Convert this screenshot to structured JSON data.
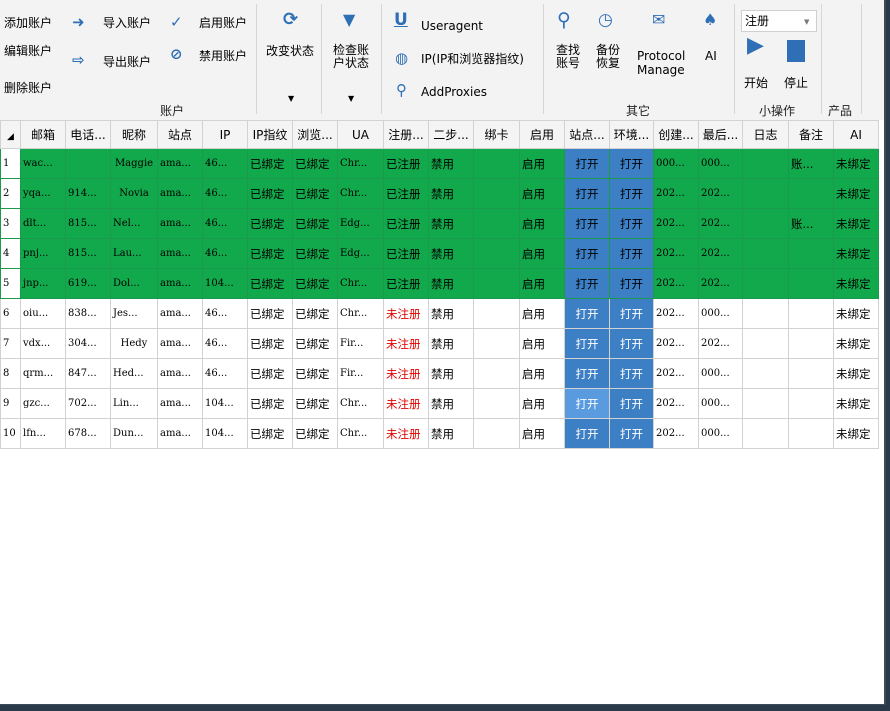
{
  "ribbon": {
    "account_group": {
      "label": "账户",
      "add": "添加账户",
      "edit": "编辑账户",
      "delete": "删除账户",
      "import": "导入账户",
      "export": "导出账户",
      "enable": "启用账户",
      "disable": "禁用账户"
    },
    "change_status": "改变状态",
    "check_status": "检查账户状态",
    "useragent": "Useragent",
    "ip_fingerprint": "IP(IP和浏览器指纹)",
    "add_proxies": "AddProxies",
    "find_account": "查找账号",
    "backup_restore": "备份恢复",
    "protocol_manage": "Protocol Manage",
    "ai": "AI",
    "other_group": "其它",
    "register_select": "注册",
    "start": "开始",
    "stop": "停止",
    "small_ops_group": "小操作",
    "product_group": "产品"
  },
  "grid": {
    "headers": [
      "邮箱",
      "电话...",
      "昵称",
      "站点",
      "IP",
      "IP指纹",
      "浏览...",
      "UA",
      "注册...",
      "二步...",
      "绑卡",
      "启用",
      "站点...",
      "环境...",
      "创建...",
      "最后...",
      "日志",
      "备注",
      "AI"
    ],
    "rows": [
      {
        "n": "1",
        "email": "wac...",
        "phone": "",
        "nick": "Maggie",
        "site": "ama...",
        "ip": "46...",
        "ipfp": "已绑定",
        "browser": "已绑定",
        "ua": "Chr...",
        "reg": "已注册",
        "twostep": "禁用",
        "card": "",
        "enabled": "启用",
        "site_open": "打开",
        "env_open": "打开",
        "created": "000...",
        "last": "000...",
        "log": "",
        "note": "账...",
        "ai": "未绑定",
        "green": true
      },
      {
        "n": "2",
        "email": "yqa...",
        "phone": "914...",
        "nick": "Novia",
        "site": "ama...",
        "ip": "46...",
        "ipfp": "已绑定",
        "browser": "已绑定",
        "ua": "Chr...",
        "reg": "已注册",
        "twostep": "禁用",
        "card": "",
        "enabled": "启用",
        "site_open": "打开",
        "env_open": "打开",
        "created": "202...",
        "last": "202...",
        "log": "",
        "note": "",
        "ai": "未绑定",
        "green": true
      },
      {
        "n": "3",
        "email": "dlt...",
        "phone": "815...",
        "nick": "Nel...",
        "site": "ama...",
        "ip": "46...",
        "ipfp": "已绑定",
        "browser": "已绑定",
        "ua": "Edg...",
        "reg": "已注册",
        "twostep": "禁用",
        "card": "",
        "enabled": "启用",
        "site_open": "打开",
        "env_open": "打开",
        "created": "202...",
        "last": "202...",
        "log": "",
        "note": "账...",
        "ai": "未绑定",
        "green": true
      },
      {
        "n": "4",
        "email": "pnj...",
        "phone": "815...",
        "nick": "Lau...",
        "site": "ama...",
        "ip": "46...",
        "ipfp": "已绑定",
        "browser": "已绑定",
        "ua": "Edg...",
        "reg": "已注册",
        "twostep": "禁用",
        "card": "",
        "enabled": "启用",
        "site_open": "打开",
        "env_open": "打开",
        "created": "202...",
        "last": "202...",
        "log": "",
        "note": "",
        "ai": "未绑定",
        "green": true
      },
      {
        "n": "5",
        "email": "jnp...",
        "phone": "619...",
        "nick": "Dol...",
        "site": "ama...",
        "ip": "104...",
        "ipfp": "已绑定",
        "browser": "已绑定",
        "ua": "Chr...",
        "reg": "已注册",
        "twostep": "禁用",
        "card": "",
        "enabled": "启用",
        "site_open": "打开",
        "env_open": "打开",
        "created": "202...",
        "last": "202...",
        "log": "",
        "note": "",
        "ai": "未绑定",
        "green": true
      },
      {
        "n": "6",
        "email": "oiu...",
        "phone": "838...",
        "nick": "Jes...",
        "site": "ama...",
        "ip": "46...",
        "ipfp": "已绑定",
        "browser": "已绑定",
        "ua": "Chr...",
        "reg": "未注册",
        "twostep": "禁用",
        "card": "",
        "enabled": "启用",
        "site_open": "打开",
        "env_open": "打开",
        "created": "202...",
        "last": "000...",
        "log": "",
        "note": "",
        "ai": "未绑定",
        "green": false
      },
      {
        "n": "7",
        "email": "vdx...",
        "phone": "304...",
        "nick": "Hedy",
        "site": "ama...",
        "ip": "46...",
        "ipfp": "已绑定",
        "browser": "已绑定",
        "ua": "Fir...",
        "reg": "未注册",
        "twostep": "禁用",
        "card": "",
        "enabled": "启用",
        "site_open": "打开",
        "env_open": "打开",
        "created": "202...",
        "last": "202...",
        "log": "",
        "note": "",
        "ai": "未绑定",
        "green": false
      },
      {
        "n": "8",
        "email": "qrm...",
        "phone": "847...",
        "nick": "Hed...",
        "site": "ama...",
        "ip": "46...",
        "ipfp": "已绑定",
        "browser": "已绑定",
        "ua": "Fir...",
        "reg": "未注册",
        "twostep": "禁用",
        "card": "",
        "enabled": "启用",
        "site_open": "打开",
        "env_open": "打开",
        "created": "202...",
        "last": "000...",
        "log": "",
        "note": "",
        "ai": "未绑定",
        "green": false
      },
      {
        "n": "9",
        "email": "gzc...",
        "phone": "702...",
        "nick": "Lin...",
        "site": "ama...",
        "ip": "104...",
        "ipfp": "已绑定",
        "browser": "已绑定",
        "ua": "Chr...",
        "reg": "未注册",
        "twostep": "禁用",
        "card": "",
        "enabled": "启用",
        "site_open": "打开",
        "env_open": "打开",
        "created": "202...",
        "last": "000...",
        "log": "",
        "note": "",
        "ai": "未绑定",
        "green": false
      },
      {
        "n": "10",
        "email": "lfn...",
        "phone": "678...",
        "nick": "Dun...",
        "site": "ama...",
        "ip": "104...",
        "ipfp": "已绑定",
        "browser": "已绑定",
        "ua": "Chr...",
        "reg": "未注册",
        "twostep": "禁用",
        "card": "",
        "enabled": "启用",
        "site_open": "打开",
        "env_open": "打开",
        "created": "202...",
        "last": "000...",
        "log": "",
        "note": "",
        "ai": "未绑定",
        "green": false
      }
    ]
  },
  "colors": {
    "green_row": "#12a84c",
    "open_button": "#3d7fc5",
    "unregistered": "#e00000",
    "accent_blue": "#2f6fb5"
  }
}
